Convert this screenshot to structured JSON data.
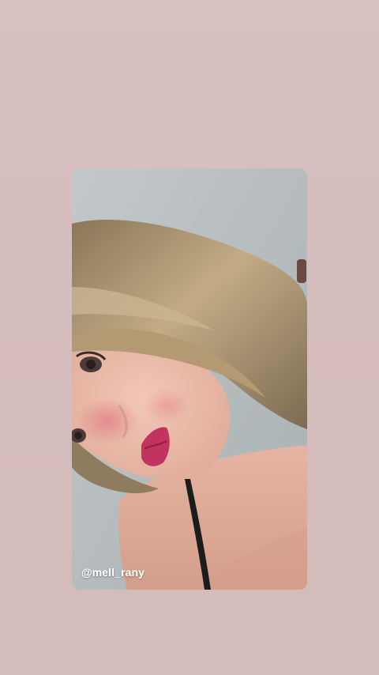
{
  "story": {
    "username": "@mell_rany"
  },
  "colors": {
    "background": "#d8c0c0",
    "wall": "#b9c0c2",
    "hair": "#a8926f",
    "skin": "#e9b6a6",
    "lips": "#c2345f",
    "strap": "#1c1c1c",
    "username_text": "#ffffff"
  },
  "media": {
    "icon": "photo-image"
  }
}
